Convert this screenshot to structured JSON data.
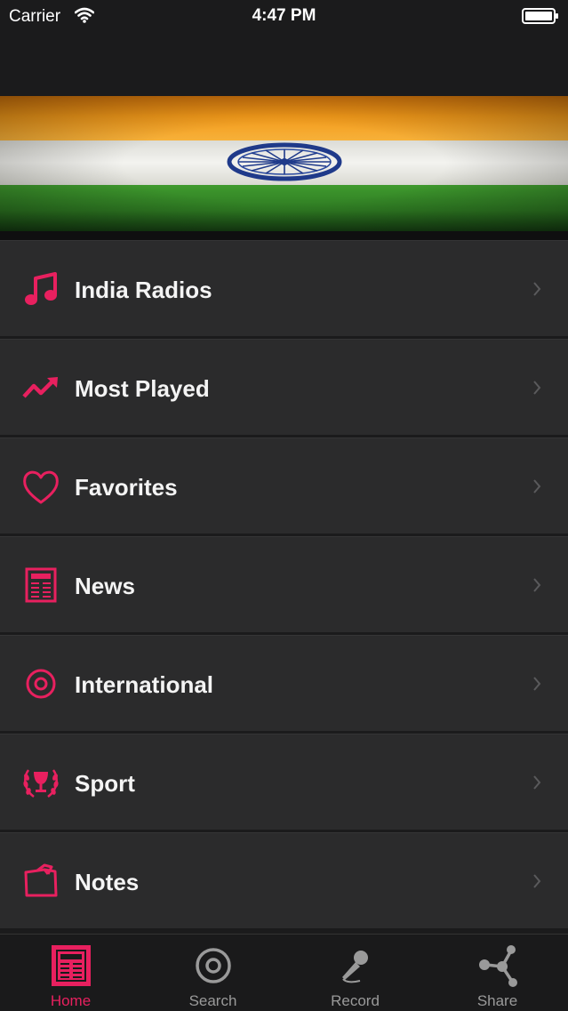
{
  "status_bar": {
    "carrier": "Carrier",
    "time": "4:47 PM"
  },
  "colors": {
    "accent": "#e8205f",
    "row_bg": "#2b2b2c",
    "bg": "#1b1b1c"
  },
  "header": {
    "banner": "india-flag-banner"
  },
  "menu": {
    "items": [
      {
        "label": "India Radios",
        "icon": "music-note-icon"
      },
      {
        "label": "Most Played",
        "icon": "trend-up-icon"
      },
      {
        "label": "Favorites",
        "icon": "heart-icon"
      },
      {
        "label": "News",
        "icon": "newspaper-icon"
      },
      {
        "label": "International",
        "icon": "disc-icon"
      },
      {
        "label": "Sport",
        "icon": "trophy-icon"
      },
      {
        "label": "Notes",
        "icon": "notes-icon"
      }
    ]
  },
  "tabbar": {
    "tabs": [
      {
        "label": "Home",
        "icon": "newspaper-icon",
        "active": true
      },
      {
        "label": "Search",
        "icon": "disc-icon",
        "active": false
      },
      {
        "label": "Record",
        "icon": "microphone-icon",
        "active": false
      },
      {
        "label": "Share",
        "icon": "share-icon",
        "active": false
      }
    ]
  }
}
